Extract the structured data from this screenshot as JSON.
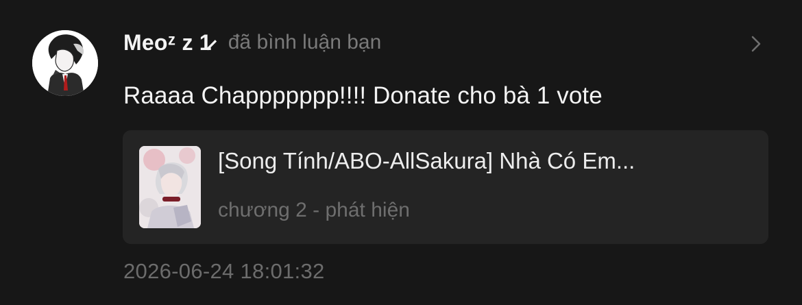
{
  "notification": {
    "user": {
      "name": "Meoᶻ z 1̷",
      "avatar_icon": "user-avatar-icon"
    },
    "action_text": "đã bình luận bạn",
    "comment_text": "Raaaa Chappppppp!!!! Donate cho bà 1 vote",
    "story": {
      "title": "[Song Tính/ABO-AllSakura] Nhà Có Em...",
      "chapter": "chương 2 - phát hiện",
      "cover_icon": "story-cover-icon"
    },
    "timestamp": "2026-06-24 18:01:32",
    "chevron_icon": "chevron-right-icon"
  },
  "colors": {
    "background": "#171717",
    "card": "#242424",
    "primary_text": "#f4f4f4",
    "secondary_text": "#7a7a7a"
  }
}
